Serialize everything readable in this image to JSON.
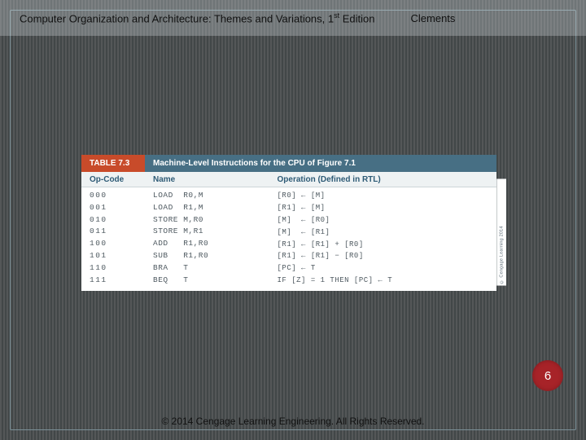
{
  "header": {
    "title_prefix": "Computer Organization and Architecture: Themes and Variations, 1",
    "title_super": "st",
    "title_suffix": " Edition",
    "author": "Clements"
  },
  "table": {
    "number": "TABLE 7.3",
    "caption": "Machine-Level Instructions for the CPU of Figure 7.1",
    "columns": {
      "opcode": "Op-Code",
      "name": "Name",
      "operation": "Operation (Defined in RTL)"
    },
    "rows": [
      {
        "opcode": "000",
        "name": "LOAD  R0,M",
        "rtl": "[R0] ← [M]"
      },
      {
        "opcode": "001",
        "name": "LOAD  R1,M",
        "rtl": "[R1] ← [M]"
      },
      {
        "opcode": "010",
        "name": "STORE M,R0",
        "rtl": "[M]  ← [R0]"
      },
      {
        "opcode": "011",
        "name": "STORE M,R1",
        "rtl": "[M]  ← [R1]"
      },
      {
        "opcode": "100",
        "name": "ADD   R1,R0",
        "rtl": "[R1] ← [R1] + [R0]"
      },
      {
        "opcode": "101",
        "name": "SUB   R1,R0",
        "rtl": "[R1] ← [R1] − [R0]"
      },
      {
        "opcode": "110",
        "name": "BRA   T",
        "rtl": "[PC] ← T"
      },
      {
        "opcode": "111",
        "name": "BEQ   T",
        "rtl": "IF [Z] = 1 THEN [PC] ← T"
      }
    ],
    "side_credit": "© Cengage Learning 2014"
  },
  "page_number": "6",
  "footer": "© 2014 Cengage Learning Engineering. All Rights Reserved."
}
